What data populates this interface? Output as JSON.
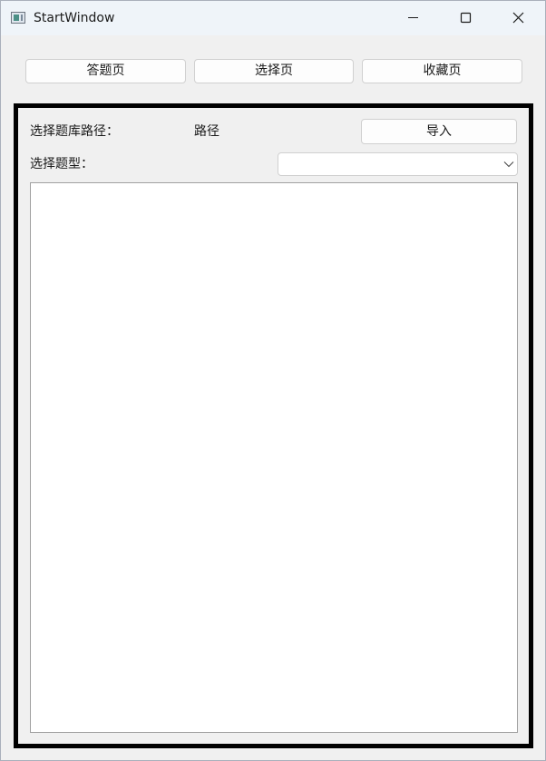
{
  "window": {
    "title": "StartWindow"
  },
  "nav": {
    "answer_page": "答题页",
    "select_page": "选择页",
    "favorites_page": "收藏页"
  },
  "form": {
    "path_label": "选择题库路径：",
    "path_value": "路径",
    "import_button": "导入",
    "type_label": "选择题型：",
    "type_selected": ""
  },
  "colors": {
    "frame_border": "#000000",
    "window_bg": "#f0f0f0",
    "titlebar_bg": "#eff4f9"
  },
  "icons": {
    "app": "app-window-icon",
    "minimize": "minimize-icon",
    "maximize": "maximize-icon",
    "close": "close-icon",
    "dropdown": "chevron-down-icon"
  }
}
